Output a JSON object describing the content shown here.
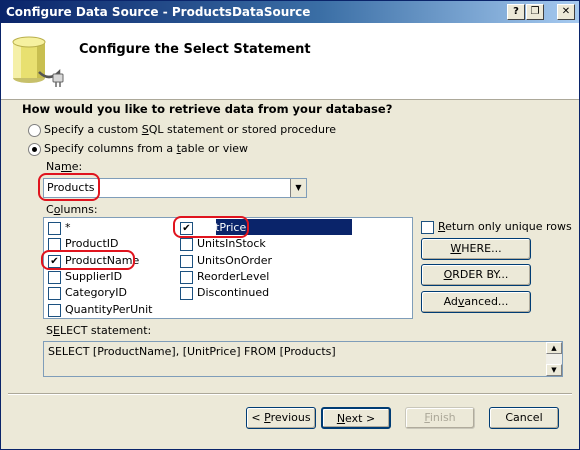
{
  "window": {
    "title": "Configure Data Source - ProductsDataSource"
  },
  "titlebar_buttons": {
    "help": "?",
    "restore": "❐",
    "close": "✕"
  },
  "header": {
    "title": "Configure the Select Statement",
    "icon": "database-plug-icon"
  },
  "question": "How would you like to retrieve data from your database?",
  "options": {
    "custom_sql": {
      "pre": "Specify a custom ",
      "key": "S",
      "post": "QL statement or stored procedure",
      "checked": false
    },
    "columns": {
      "pre": "Specify columns from a ",
      "key": "t",
      "post": "able or view",
      "checked": true
    }
  },
  "name_label": {
    "pre": "Na",
    "key": "m",
    "post": "e:"
  },
  "table_name": "Products",
  "columns_label": {
    "pre": "C",
    "key": "o",
    "post": "lumns:"
  },
  "columns_col1": [
    {
      "label": "*",
      "checked": false
    },
    {
      "label": "ProductID",
      "checked": false
    },
    {
      "label": "ProductName",
      "checked": true
    },
    {
      "label": "SupplierID",
      "checked": false
    },
    {
      "label": "CategoryID",
      "checked": false
    },
    {
      "label": "QuantityPerUnit",
      "checked": false
    }
  ],
  "columns_col2": [
    {
      "label": "UnitPrice",
      "checked": true,
      "selected": true
    },
    {
      "label": "UnitsInStock",
      "checked": false
    },
    {
      "label": "UnitsOnOrder",
      "checked": false
    },
    {
      "label": "ReorderLevel",
      "checked": false
    },
    {
      "label": "Discontinued",
      "checked": false
    }
  ],
  "return_unique": {
    "pre": "",
    "key": "R",
    "post": "eturn only unique rows",
    "checked": false
  },
  "side_buttons": {
    "where": {
      "pre": "",
      "key": "W",
      "post": "HERE..."
    },
    "order_by": {
      "pre": "",
      "key": "O",
      "post": "RDER BY..."
    },
    "advanced": {
      "pre": "Ad",
      "key": "v",
      "post": "anced..."
    }
  },
  "select_label": {
    "pre": "S",
    "key": "E",
    "post": "LECT statement:"
  },
  "select_statement": "SELECT [ProductName], [UnitPrice] FROM [Products]",
  "footer_buttons": {
    "previous": {
      "pre": "< ",
      "key": "P",
      "post": "revious"
    },
    "next": {
      "pre": "",
      "key": "N",
      "post": "ext >"
    },
    "finish": {
      "pre": "",
      "key": "F",
      "post": "inish"
    },
    "cancel": "Cancel"
  },
  "colors": {
    "title_start": "#0a246a",
    "title_end": "#a6caf0",
    "highlight": "#e0141e",
    "selection": "#0a246a",
    "face": "#ece9d8"
  }
}
